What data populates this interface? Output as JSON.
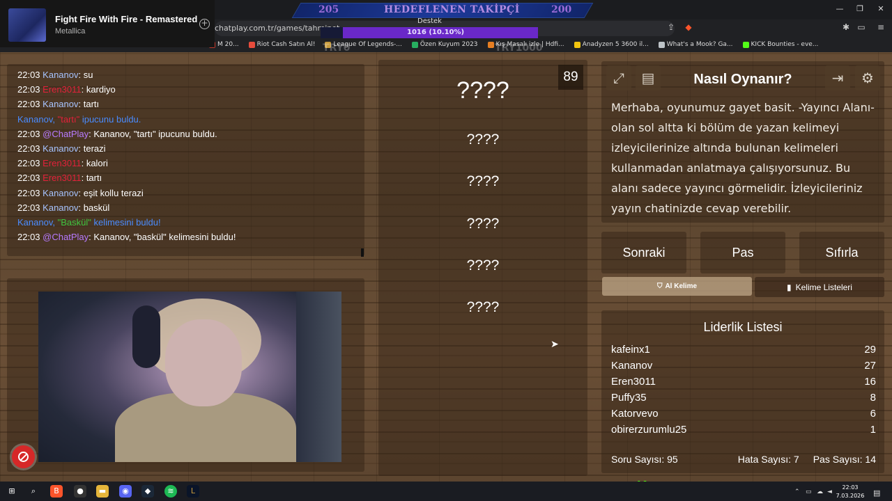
{
  "media": {
    "song": "Fight Fire With Fire - Remastered",
    "artist": "Metallica"
  },
  "browser": {
    "url": "chatplay.com.tr/games/tahminet",
    "bookmarks": [
      {
        "label": "M 20...",
        "color": "#c0392b"
      },
      {
        "label": "Riot Cash Satın Al!",
        "color": "#e74c3c"
      },
      {
        "label": "League Of Legends-...",
        "color": "#c89b3c"
      },
      {
        "label": "Özen Kuyum 2023",
        "color": "#27ae60"
      },
      {
        "label": "Kış Masalı izle | Hdfi...",
        "color": "#e67e22"
      },
      {
        "label": "Anadyzen 5 3600 il...",
        "color": "#f1c40f"
      },
      {
        "label": "What's a Mook? Ga...",
        "color": "#bdc3c7"
      },
      {
        "label": "KICK Bounties - eve...",
        "color": "#53fc18"
      }
    ]
  },
  "goal": {
    "left": "205",
    "title": "HEDEFLENEN TAKİPÇİ",
    "right": "200"
  },
  "support": {
    "label": "Destek",
    "progress_text": "1016 (10.10%)",
    "progress": 0.898
  },
  "try_labels": {
    "left": "TRY0",
    "right": "TRY1000"
  },
  "chat": {
    "messages": [
      {
        "type": "msg",
        "time": "22:03",
        "user": "Kananov",
        "ucls": "u1",
        "text": ": su"
      },
      {
        "type": "msg",
        "time": "22:03",
        "user": "Eren3011",
        "ucls": "u2",
        "text": ": kardiyo"
      },
      {
        "type": "msg",
        "time": "22:03",
        "user": "Kananov",
        "ucls": "u1",
        "text": ": tartı"
      },
      {
        "type": "sys",
        "pre": "Kananov, ",
        "hl": "\"tartı\"",
        "hlcls": "red",
        "post": " ipucunu buldu."
      },
      {
        "type": "msg",
        "time": "22:03",
        "user": "@ChatPlay",
        "ucls": "cp",
        "text": ": Kananov, \"tartı\" ipucunu buldu."
      },
      {
        "type": "msg",
        "time": "22:03",
        "user": "Kananov",
        "ucls": "u1",
        "text": ": terazi"
      },
      {
        "type": "msg",
        "time": "22:03",
        "user": "Eren3011",
        "ucls": "u2",
        "text": ": kalori"
      },
      {
        "type": "msg",
        "time": "22:03",
        "user": "Eren3011",
        "ucls": "u2",
        "text": ": tartı"
      },
      {
        "type": "msg",
        "time": "22:03",
        "user": "Kananov",
        "ucls": "u1",
        "text": ": eşit kollu terazi"
      },
      {
        "type": "msg",
        "time": "22:03",
        "user": "Kananov",
        "ucls": "u1",
        "text": ": baskül"
      },
      {
        "type": "sys",
        "pre": "Kananov, ",
        "hl": "\"Baskül\"",
        "hlcls": "grn",
        "post": " kelimesini buldu!"
      },
      {
        "type": "msg",
        "time": "22:03",
        "user": "@ChatPlay",
        "ucls": "cp",
        "text": ": Kananov, \"baskül\" kelimesini buldu!"
      }
    ]
  },
  "words": {
    "counter": "89",
    "main": "????",
    "hints": [
      "????",
      "????",
      "????",
      "????",
      "????"
    ]
  },
  "info": {
    "title": "Nasıl Oynanır?",
    "description": "Merhaba, oyunumuz gayet basit. -Yayıncı Alanı- olan sol altta ki bölüm de yazan kelimeyi izleyicilerinize altında bulunan kelimeleri kullanmadan anlatmaya çalışıyorsunuz. Bu alanı sadece yayıncı görmelidir. İzleyicileriniz yayın chatinizde cevap verebilir."
  },
  "actions": {
    "next": "Sonraki",
    "pass": "Pas",
    "reset": "Sıfırla",
    "get_word": "Al Kelime",
    "word_lists": "Kelime Listeleri"
  },
  "leaderboard": {
    "title": "Liderlik Listesi",
    "rows": [
      {
        "name": "kafeinx1",
        "score": "29"
      },
      {
        "name": "Kananov",
        "score": "27"
      },
      {
        "name": "Eren3011",
        "score": "16"
      },
      {
        "name": "Puffy35",
        "score": "8"
      },
      {
        "name": "Katorvevo",
        "score": "6"
      },
      {
        "name": "obirerzurumlu25",
        "score": "1"
      }
    ]
  },
  "stats": {
    "questions": "Soru Sayısı: 95",
    "errors": "Hata Sayısı: 7",
    "passes": "Pas Sayısı: 14"
  },
  "taskbar": {
    "time": "22:03",
    "date": "7.03.2026"
  },
  "kick": {
    "logo": "K"
  }
}
